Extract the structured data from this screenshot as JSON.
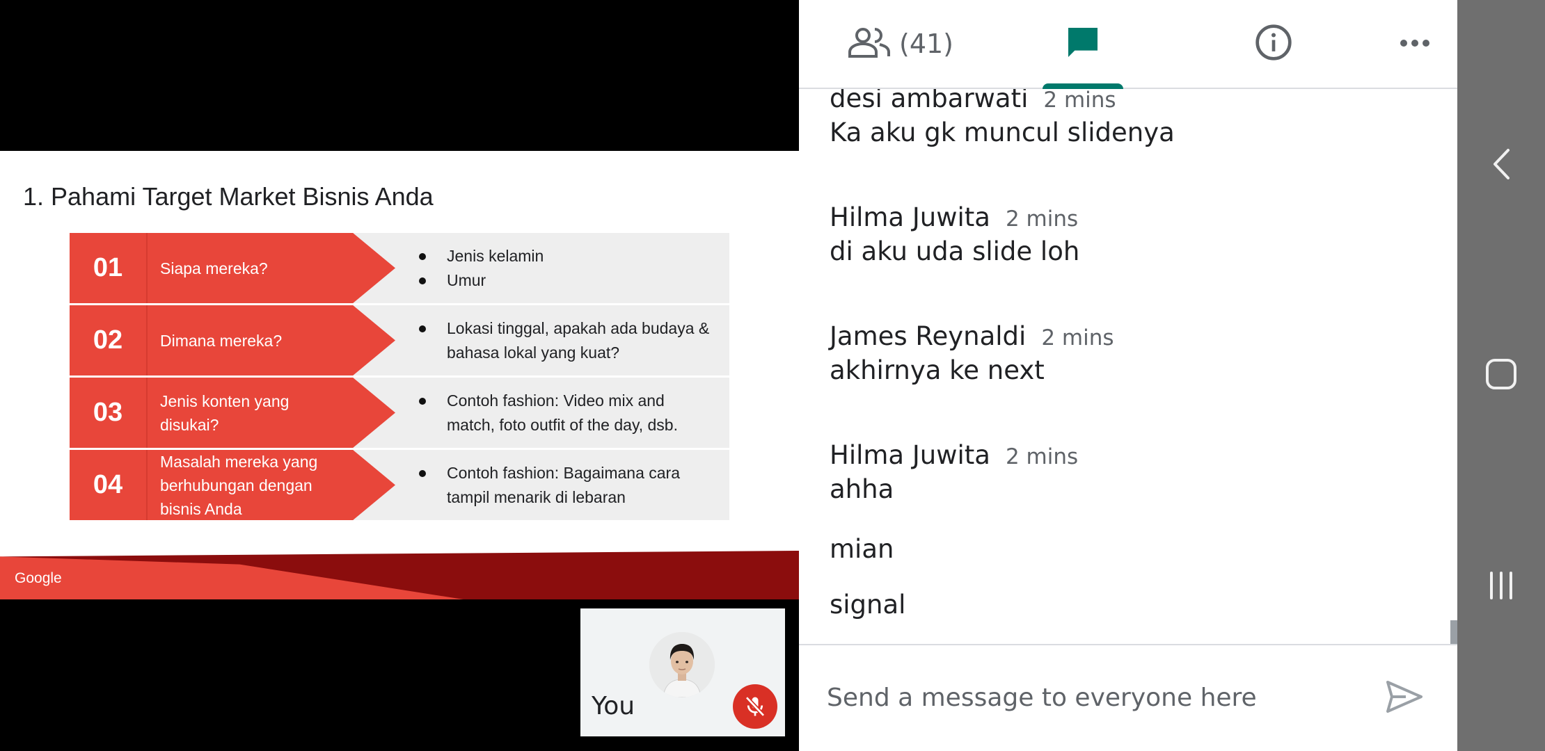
{
  "slide": {
    "title": "1. Pahami Target Market Bisnis Anda",
    "rows": [
      {
        "number": "01",
        "question": "Siapa mereka?",
        "bullets": [
          "Jenis kelamin",
          "Umur"
        ]
      },
      {
        "number": "02",
        "question": "Dimana mereka?",
        "bullets": [
          "Lokasi tinggal, apakah ada budaya & bahasa lokal yang kuat?"
        ]
      },
      {
        "number": "03",
        "question": "Jenis konten yang disukai?",
        "bullets": [
          "Contoh fashion: Video mix and match, foto outfit of the day, dsb."
        ]
      },
      {
        "number": "04",
        "question": "Masalah mereka yang berhubungan dengan bisnis Anda",
        "bullets": [
          "Contoh fashion: Bagaimana cara tampil menarik di lebaran"
        ]
      }
    ],
    "footer_brand": "Google",
    "colors": {
      "accent_red": "#e8463a",
      "dark_red": "#8b0d0d"
    }
  },
  "self_tile": {
    "label": "You",
    "mic_state": "muted",
    "mic_icon": "mic-off-icon"
  },
  "tabs": {
    "people_count": "(41)",
    "active": "chat",
    "accent": "#00796b",
    "icons": [
      "people-icon",
      "chat-icon",
      "info-icon",
      "more-icon"
    ]
  },
  "messages": [
    {
      "sender": "desi ambarwati",
      "time": "2 mins",
      "text": "Ka aku gk muncul slidenya"
    },
    {
      "sender": "Hilma Juwita",
      "time": "2 mins",
      "text": "di aku uda slide loh"
    },
    {
      "sender": "James Reynaldi",
      "time": "2 mins",
      "text": "akhirnya ke next"
    },
    {
      "sender": "Hilma Juwita",
      "time": "2 mins",
      "text": "ahha"
    }
  ],
  "followups": [
    "mian",
    "signal"
  ],
  "composer": {
    "placeholder": "Send a message to everyone here",
    "send_icon": "send-icon"
  },
  "system_nav": {
    "icons": [
      "back-icon",
      "home-icon",
      "recents-icon"
    ]
  }
}
